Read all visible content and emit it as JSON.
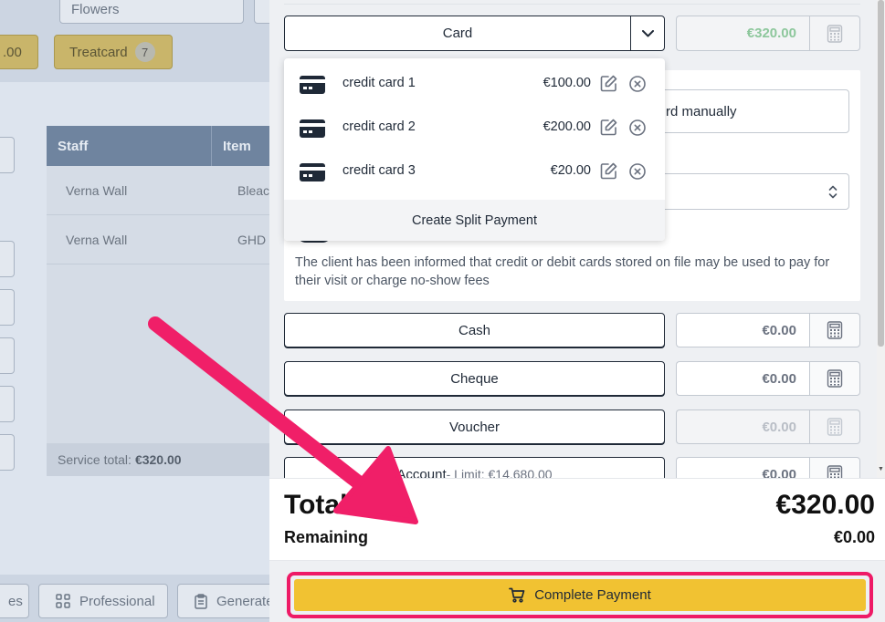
{
  "background": {
    "top_chips": [
      {
        "label": "Flowers"
      },
      {
        "label": ".00"
      },
      {
        "label": "Treatcard",
        "badge": "7"
      }
    ],
    "table": {
      "headers": [
        "Staff",
        "Item"
      ],
      "rows": [
        {
          "staff": "Verna Wall",
          "item": "Bleac"
        },
        {
          "staff": "Verna Wall",
          "item": "GHD"
        }
      ],
      "service_total_label": "Service total:",
      "service_total_value": "€320.00"
    },
    "bottom_buttons": [
      {
        "label": "es"
      },
      {
        "label": "Professional"
      },
      {
        "label": "Generate"
      }
    ]
  },
  "payment": {
    "card_label": "Card",
    "card_amount": "€320.00",
    "enter_manually_label": "rd manually",
    "consent_text": "The client has been informed that credit or debit cards stored on file may be used to pay for their visit or charge no-show fees",
    "methods": [
      {
        "label": "Cash",
        "amount": "€0.00"
      },
      {
        "label": "Cheque",
        "amount": "€0.00"
      },
      {
        "label": "Voucher",
        "amount": "€0.00"
      },
      {
        "label": "Account",
        "sub": " - Limit: €14,680.00",
        "amount": "€0.00"
      }
    ]
  },
  "dropdown": {
    "cards": [
      {
        "name": "credit card 1",
        "amount": "€100.00"
      },
      {
        "name": "credit card 2",
        "amount": "€200.00"
      },
      {
        "name": "credit card 3",
        "amount": "€20.00"
      }
    ],
    "split_label": "Create Split Payment"
  },
  "totals": {
    "total_label": "Total",
    "total_value": "€320.00",
    "remaining_label": "Remaining",
    "remaining_value": "€0.00"
  },
  "footer": {
    "complete_label": "Complete Payment"
  },
  "colors": {
    "highlight": "#ee1a66",
    "complete_button": "#f1c232",
    "card_amount_green": "#8dc79c"
  },
  "icons": {
    "dropdown_toggle": "chevron-down-icon",
    "calculator": "calculator-icon",
    "card": "credit-card-icon",
    "edit": "edit-icon",
    "remove": "remove-circle-icon",
    "cart": "cart-icon",
    "select": "updown-chevron-icon",
    "annotation": "annotation-arrow"
  }
}
